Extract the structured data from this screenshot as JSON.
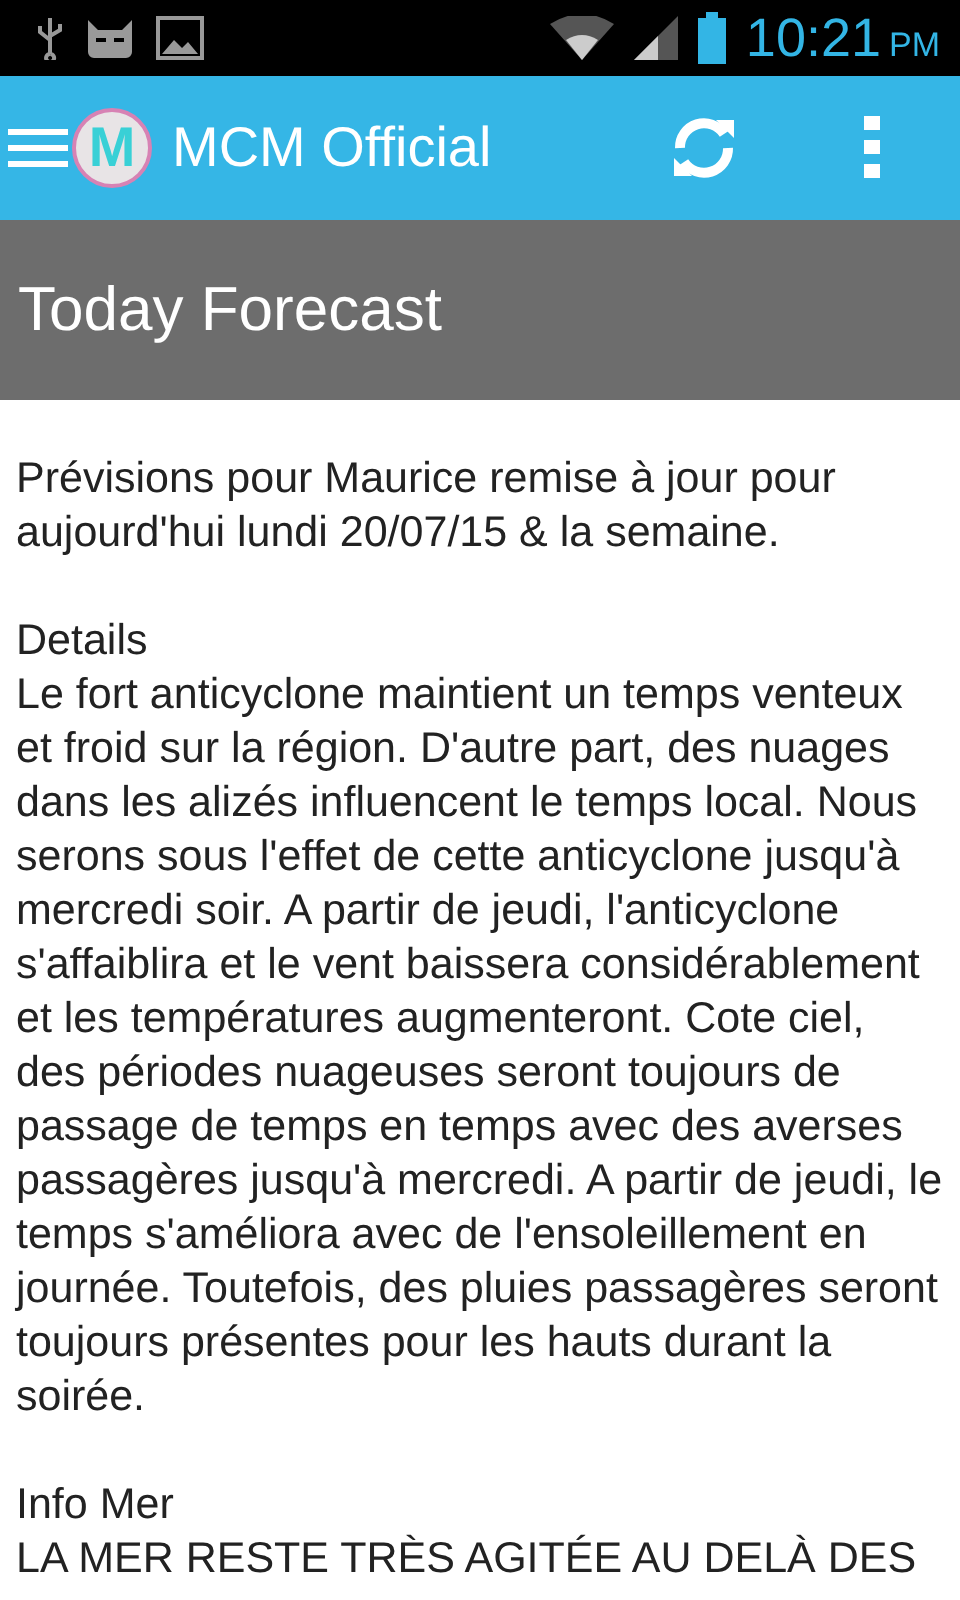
{
  "status_bar": {
    "time": "10:21",
    "meridiem": "PM"
  },
  "app_bar": {
    "title": "MCM Official",
    "logo_letter": "M"
  },
  "header": {
    "title": "Today Forecast"
  },
  "sections": [
    {
      "kind": "paragraph",
      "text": "Prévisions pour Maurice remise à jour pour aujourd'hui lundi 20/07/15 & la semaine."
    },
    {
      "kind": "heading",
      "text": "Details"
    },
    {
      "kind": "paragraph",
      "text": "Le fort anticyclone maintient un temps venteux et froid sur la région. D'autre part, des nuages dans les alizés influencent le temps local. Nous serons sous l'effet de cette anticyclone jusqu'à mercredi soir. A partir de jeudi, l'anticyclone s'affaiblira et le vent baissera considérablement et les températures augmenteront. Cote ciel, des périodes nuageuses seront toujours de passage de temps en temps avec des averses passagères jusqu'à mercredi. A partir de jeudi, le temps s'améliora avec de l'ensoleillement en journée. Toutefois, des pluies passagères seront toujours présentes pour les hauts durant la soirée."
    },
    {
      "kind": "heading",
      "text": "Info Mer"
    },
    {
      "kind": "paragraph",
      "text": "LA MER RESTE TRÈS AGITÉE AU DELÀ DES"
    }
  ]
}
